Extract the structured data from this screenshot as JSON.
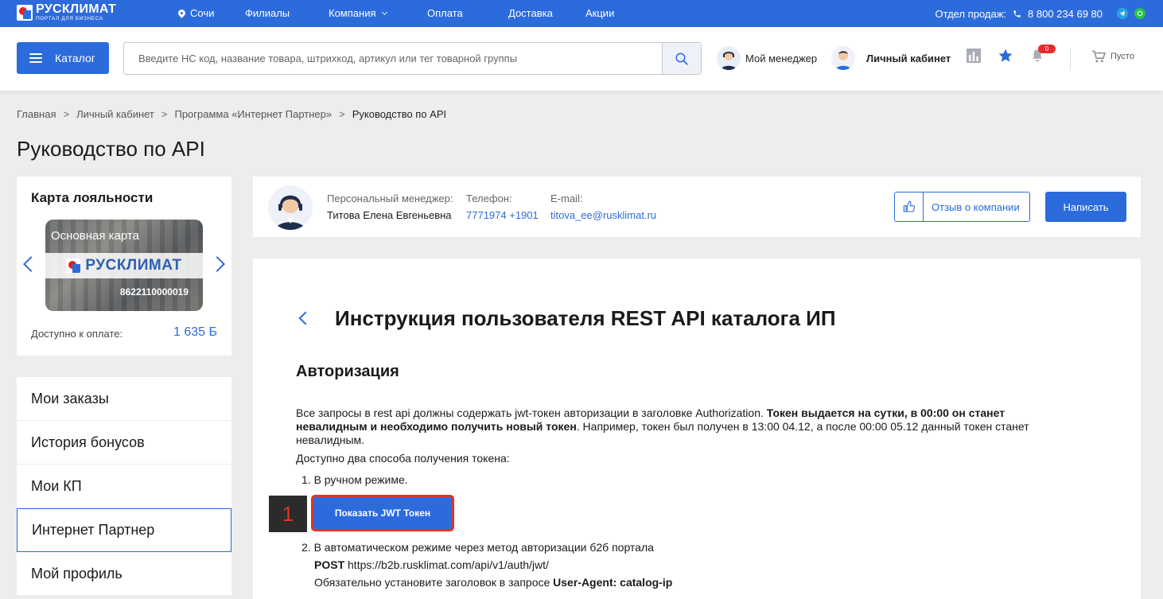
{
  "topbar": {
    "logo_main": "РУСКЛИМАТ",
    "logo_sub": "ПОРТАЛ ДЛЯ БИЗНЕСА",
    "city": "Сочи",
    "nav": [
      "Филиалы",
      "Компания",
      "Оплата",
      "Доставка",
      "Акции"
    ],
    "sales_label": "Отдел продаж:",
    "phone": "8 800 234 69 80",
    "bg_color": "#2c6bdc"
  },
  "header": {
    "catalog_label": "Каталог",
    "search_placeholder": "Введите НС код, название товара, штрихкод, артикул или тег товарной группы",
    "manager_label": "Мой менеджер",
    "cabinet_label": "Личный кабинет",
    "notifications_count": "0",
    "cart_label": "Пусто"
  },
  "breadcrumbs": [
    "Главная",
    "Личный кабинет",
    "Программа «Интернет Партнер»",
    "Руководство по API"
  ],
  "page_title": "Руководство по API",
  "loyalty": {
    "title": "Карта лояльности",
    "card_name": "Основная карта",
    "card_brand": "РУСКЛИМАТ",
    "card_number": "8622110000019",
    "available_label": "Доступно к оплате:",
    "available_value": "1 635 Б"
  },
  "side_menu": [
    {
      "label": "Мои заказы"
    },
    {
      "label": "История бонусов"
    },
    {
      "label": "Мои КП"
    },
    {
      "label": "Интернет Партнер"
    },
    {
      "label": "Мой профиль"
    }
  ],
  "manager": {
    "personal_label": "Персональный менеджер:",
    "name": "Титова Елена Евгеньевна",
    "phone_label": "Телефон:",
    "phone": "7771974 +1901",
    "email_label": "E-mail:",
    "email": "titova_ee@rusklimat.ru",
    "review_label": "Отзыв о компании",
    "write_label": "Написать"
  },
  "content": {
    "title": "Инструкция пользователя REST API каталога ИП",
    "section": "Авторизация",
    "p1_a": "Все запросы в rest api должны содержать jwt-токен авторизации в заголовке Authorization. ",
    "p1_b": "Токен выдается на сутки, в 00:00 он станет невалидным и необходимо получить новый токен",
    "p1_c": ". Например, токен был получен в 13:00 04.12, а после 00:00 05.12 данный токен станет невалидным.",
    "p2": "Доступно два способа получения токена:",
    "step1": "1. В ручном режиме.",
    "jwt_button": "Показать JWT Токен",
    "annotation": "1",
    "step2": "2. В автоматическом режиме через метод авторизации б2б портала",
    "post_method": "POST",
    "post_url": " https://b2b.rusklimat.com/api/v1/auth/jwt/",
    "header_note_a": "Обязательно установите заголовок в запросе ",
    "header_note_b": "User-Agent: catalog-ip"
  }
}
